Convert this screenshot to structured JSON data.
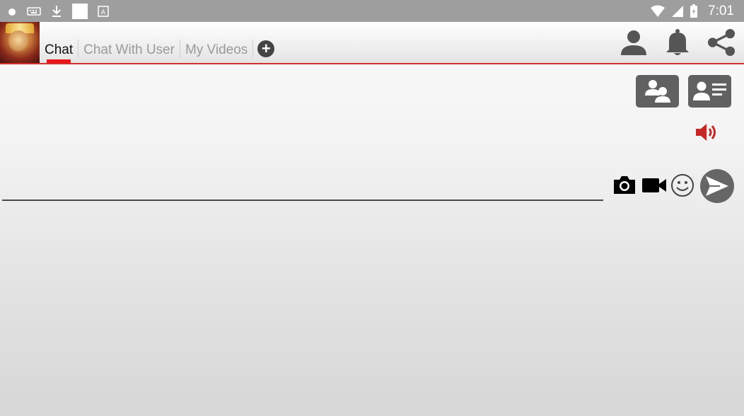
{
  "status_bar": {
    "time": "7:01",
    "left_icons": [
      "circle-icon",
      "keyboard-icon",
      "download-icon",
      "white-square-icon",
      "a-box-icon"
    ],
    "right_icons": [
      "wifi-icon",
      "signal-icon",
      "battery-icon"
    ]
  },
  "app_bar": {
    "avatar": "profile-avatar-image",
    "tabs": [
      {
        "label": "Chat",
        "active": true
      },
      {
        "label": "Chat With User",
        "active": false
      },
      {
        "label": "My Videos",
        "active": false
      }
    ],
    "add_tab_symbol": "+",
    "actions": [
      "person-icon",
      "bell-icon",
      "share-icon"
    ],
    "accent_color": "#e8161b"
  },
  "chat_controls": {
    "buttons": [
      "group-users-icon",
      "user-card-icon"
    ],
    "speaker_icon": "volume-icon",
    "speaker_color": "#c62828"
  },
  "composer": {
    "message_value": "",
    "icons": [
      "camera-icon",
      "video-camera-icon",
      "smiley-icon",
      "send-icon"
    ]
  }
}
